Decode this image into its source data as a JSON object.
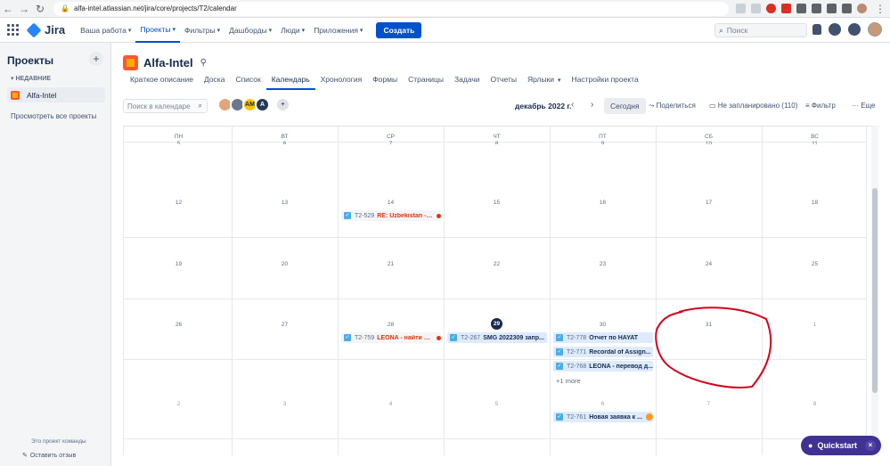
{
  "browser": {
    "url": "alfa-intel.atlassian.net/jira/core/projects/T2/calendar"
  },
  "topnav": {
    "logo": "Jira",
    "menu": [
      {
        "label": "Ваша работа"
      },
      {
        "label": "Проекты"
      },
      {
        "label": "Фильтры"
      },
      {
        "label": "Дашборды"
      },
      {
        "label": "Люди"
      },
      {
        "label": "Приложения"
      }
    ],
    "create": "Создать",
    "search_placeholder": "Поиск"
  },
  "sidebar": {
    "title": "Проекты",
    "add": "+",
    "recent": "НЕДАВНИЕ",
    "project": "Alfa-Intel",
    "all_projects": "Просмотреть все проекты",
    "team_note": "Это проект команды",
    "feedback": "Оставить отзыв"
  },
  "project": {
    "name": "Alfa-Intel",
    "tabs": [
      "Краткое описание",
      "Доска",
      "Список",
      "Календарь",
      "Хронология",
      "Формы",
      "Страницы",
      "Задачи",
      "Отчеты",
      "Ярлыки",
      "Настройки проекта"
    ]
  },
  "toolbar": {
    "search_placeholder": "Поиск в календаре",
    "avatar_initials": [
      "",
      "",
      "AM",
      "A"
    ],
    "month": "декабрь 2022 г.",
    "today": "Сегодня",
    "share": "Поделиться",
    "unscheduled": "Не запланировано (110)",
    "filter": "Фильтр",
    "more": "Еще"
  },
  "calendar": {
    "weekdays": [
      "ПН",
      "ВТ",
      "СР",
      "ЧТ",
      "ПТ",
      "СБ",
      "ВС"
    ],
    "weeks": [
      [
        "5",
        "6",
        "7",
        "8",
        "9",
        "10",
        "11"
      ],
      [
        "12",
        "13",
        "14",
        "15",
        "16",
        "17",
        "18"
      ],
      [
        "19",
        "20",
        "21",
        "22",
        "23",
        "24",
        "25"
      ],
      [
        "26",
        "27",
        "28",
        "29",
        "30",
        "31",
        "1"
      ],
      [
        "2",
        "3",
        "4",
        "5",
        "6",
        "7",
        "8"
      ]
    ],
    "events": [
      {
        "key": "T2-529",
        "title": "RE: Uzbekistan - ..."
      },
      {
        "key": "T2-759",
        "title": "LEONA - найти д..."
      },
      {
        "key": "T2-267",
        "title": "SMG 2022309 запр..."
      },
      {
        "key": "T2-778",
        "title": "Отчет по HAYAT"
      },
      {
        "key": "T2-771",
        "title": "Recordal of Assign..."
      },
      {
        "key": "T2-768",
        "title": "LEONA - перевод д..."
      },
      {
        "key": "T2-761",
        "title": "Новая заявка к ..."
      }
    ],
    "more_link": "+1 more"
  },
  "quickstart": "Quickstart"
}
